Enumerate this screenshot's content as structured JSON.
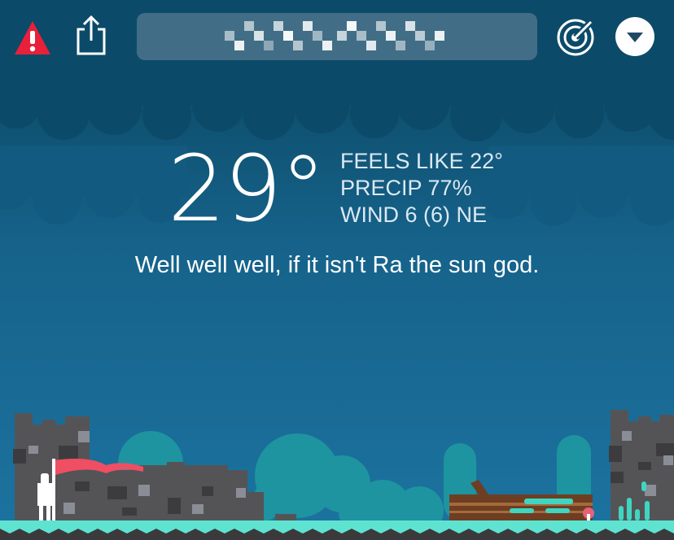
{
  "header": {
    "alert_icon": "alert-triangle-icon",
    "share_icon": "share-icon",
    "radar_icon": "radar-icon",
    "menu_icon": "chevron-down-icon",
    "location_text": ""
  },
  "weather": {
    "temperature": "29°",
    "feels_like": "FEELS LIKE 22°",
    "precip": "PRECIP 77%",
    "wind": "WIND 6 (6) NE",
    "quip": "Well well well, if it isn't Ra the sun god."
  },
  "colors": {
    "sky_top": "#0d4a68",
    "sky_bottom": "#1b6f99",
    "cloud": "#135a7c",
    "alert": "#e8203a",
    "ground": "#5ee0cf",
    "castle": "#535356",
    "flag": "#f04e63",
    "foliage": "#1e9aa5"
  }
}
